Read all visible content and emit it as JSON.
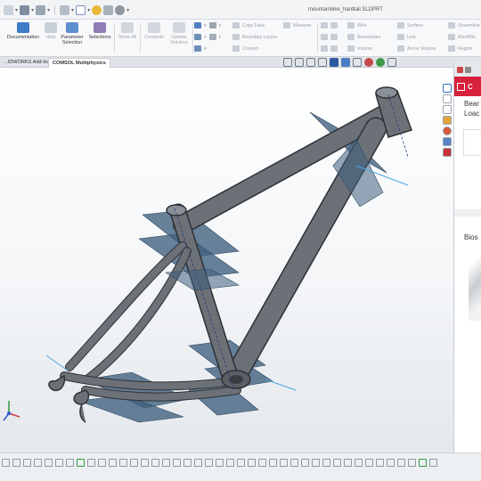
{
  "window": {
    "document_title": "mountainbike_hardtail.SLDPRT"
  },
  "quick_access": [
    {
      "name": "sw-logo-icon"
    },
    {
      "name": "new-file-icon"
    },
    {
      "name": "save-icon"
    },
    {
      "name": "print-icon"
    },
    {
      "name": "undo-icon"
    },
    {
      "name": "select-icon"
    },
    {
      "name": "rebuild-icon"
    },
    {
      "name": "options-icon"
    }
  ],
  "ribbon": {
    "buttons": [
      {
        "label_1": "Documentation",
        "label_2": "",
        "enabled": true
      },
      {
        "label_1": "Help",
        "label_2": "",
        "enabled": false
      },
      {
        "label_1": "Parameter",
        "label_2": "Selection",
        "enabled": true
      },
      {
        "label_1": "Selections",
        "label_2": "",
        "enabled": true
      },
      {
        "label_1": "Show All",
        "label_2": "",
        "enabled": false
      },
      {
        "label_1": "Compute",
        "label_2": "",
        "enabled": false
      },
      {
        "label_1": "Update",
        "label_2": "Solution",
        "enabled": false
      }
    ],
    "small_tools": [
      {
        "label": "Copy Face"
      },
      {
        "label": "Boundary Layers"
      },
      {
        "label": "Convert"
      },
      {
        "label": "Measure"
      },
      {
        "label": "Wire"
      },
      {
        "label": "Boundaries"
      },
      {
        "label": "Volume"
      },
      {
        "label": "Surface"
      },
      {
        "label": "Line"
      },
      {
        "label": "Arrow Volume"
      },
      {
        "label": "Streamline"
      },
      {
        "label": "Max/Min"
      },
      {
        "label": "Region"
      }
    ]
  },
  "tabs": [
    {
      "label": "...IDWORKS Add-Ins",
      "active": false
    },
    {
      "label": "COMSOL Multiphysics",
      "active": true
    }
  ],
  "right_panel": {
    "brand": "C",
    "heading_1": "Bear",
    "heading_2": "Loac",
    "section_2": "Bios"
  },
  "colors": {
    "brand_red": "#d7203b",
    "frame_fill": "#6c7178",
    "plane_fill": "#3f5f7d",
    "axis_x": "#d23c3c",
    "axis_y": "#2e9b3a",
    "axis_z": "#3355cc"
  }
}
